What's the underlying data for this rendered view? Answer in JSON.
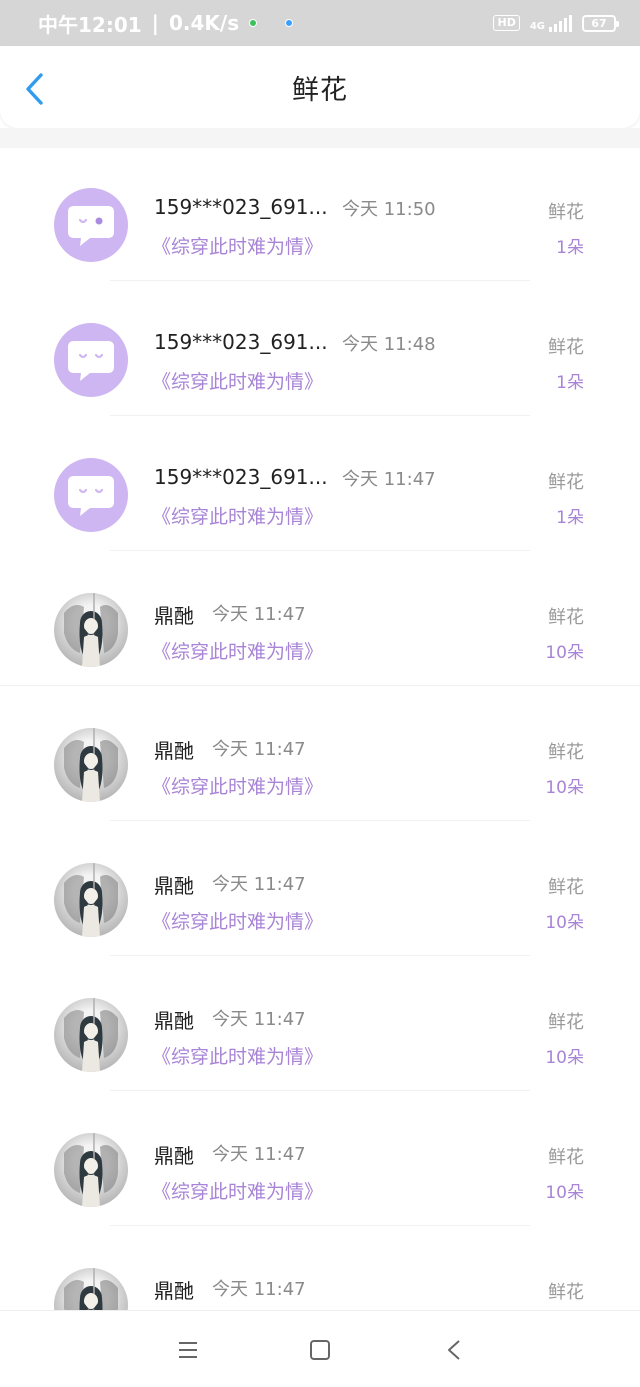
{
  "status_bar": {
    "time": "中午12:01",
    "speed": "0.4K/s",
    "hd": "HD",
    "network": "4G",
    "battery": "67"
  },
  "header": {
    "title": "鲜花"
  },
  "records": [
    {
      "name": "159***023_691...",
      "time": "今天 11:50",
      "book": "《综穿此时难为情》",
      "gift": "鲜花",
      "count": "1朵",
      "avatar": "chat-icon"
    },
    {
      "name": "159***023_691...",
      "time": "今天 11:48",
      "book": "《综穿此时难为情》",
      "gift": "鲜花",
      "count": "1朵",
      "avatar": "chat-icon"
    },
    {
      "name": "159***023_691...",
      "time": "今天 11:47",
      "book": "《综穿此时难为情》",
      "gift": "鲜花",
      "count": "1朵",
      "avatar": "chat-icon"
    },
    {
      "name": "鼎酏",
      "time": "今天 11:47",
      "book": "《综穿此时难为情》",
      "gift": "鲜花",
      "count": "10朵",
      "avatar": "anime-girl"
    },
    {
      "name": "鼎酏",
      "time": "今天 11:47",
      "book": "《综穿此时难为情》",
      "gift": "鲜花",
      "count": "10朵",
      "avatar": "anime-girl"
    },
    {
      "name": "鼎酏",
      "time": "今天 11:47",
      "book": "《综穿此时难为情》",
      "gift": "鲜花",
      "count": "10朵",
      "avatar": "anime-girl"
    },
    {
      "name": "鼎酏",
      "time": "今天 11:47",
      "book": "《综穿此时难为情》",
      "gift": "鲜花",
      "count": "10朵",
      "avatar": "anime-girl"
    },
    {
      "name": "鼎酏",
      "time": "今天 11:47",
      "book": "《综穿此时难为情》",
      "gift": "鲜花",
      "count": "10朵",
      "avatar": "anime-girl"
    },
    {
      "name": "鼎酏",
      "time": "今天 11:47",
      "book": "",
      "gift": "鲜花",
      "count": "",
      "avatar": "anime-girl"
    }
  ],
  "colors": {
    "accent": "#a884d6",
    "back_arrow": "#2f9cf0",
    "chat_avatar_bg": "#cdb6f2"
  }
}
